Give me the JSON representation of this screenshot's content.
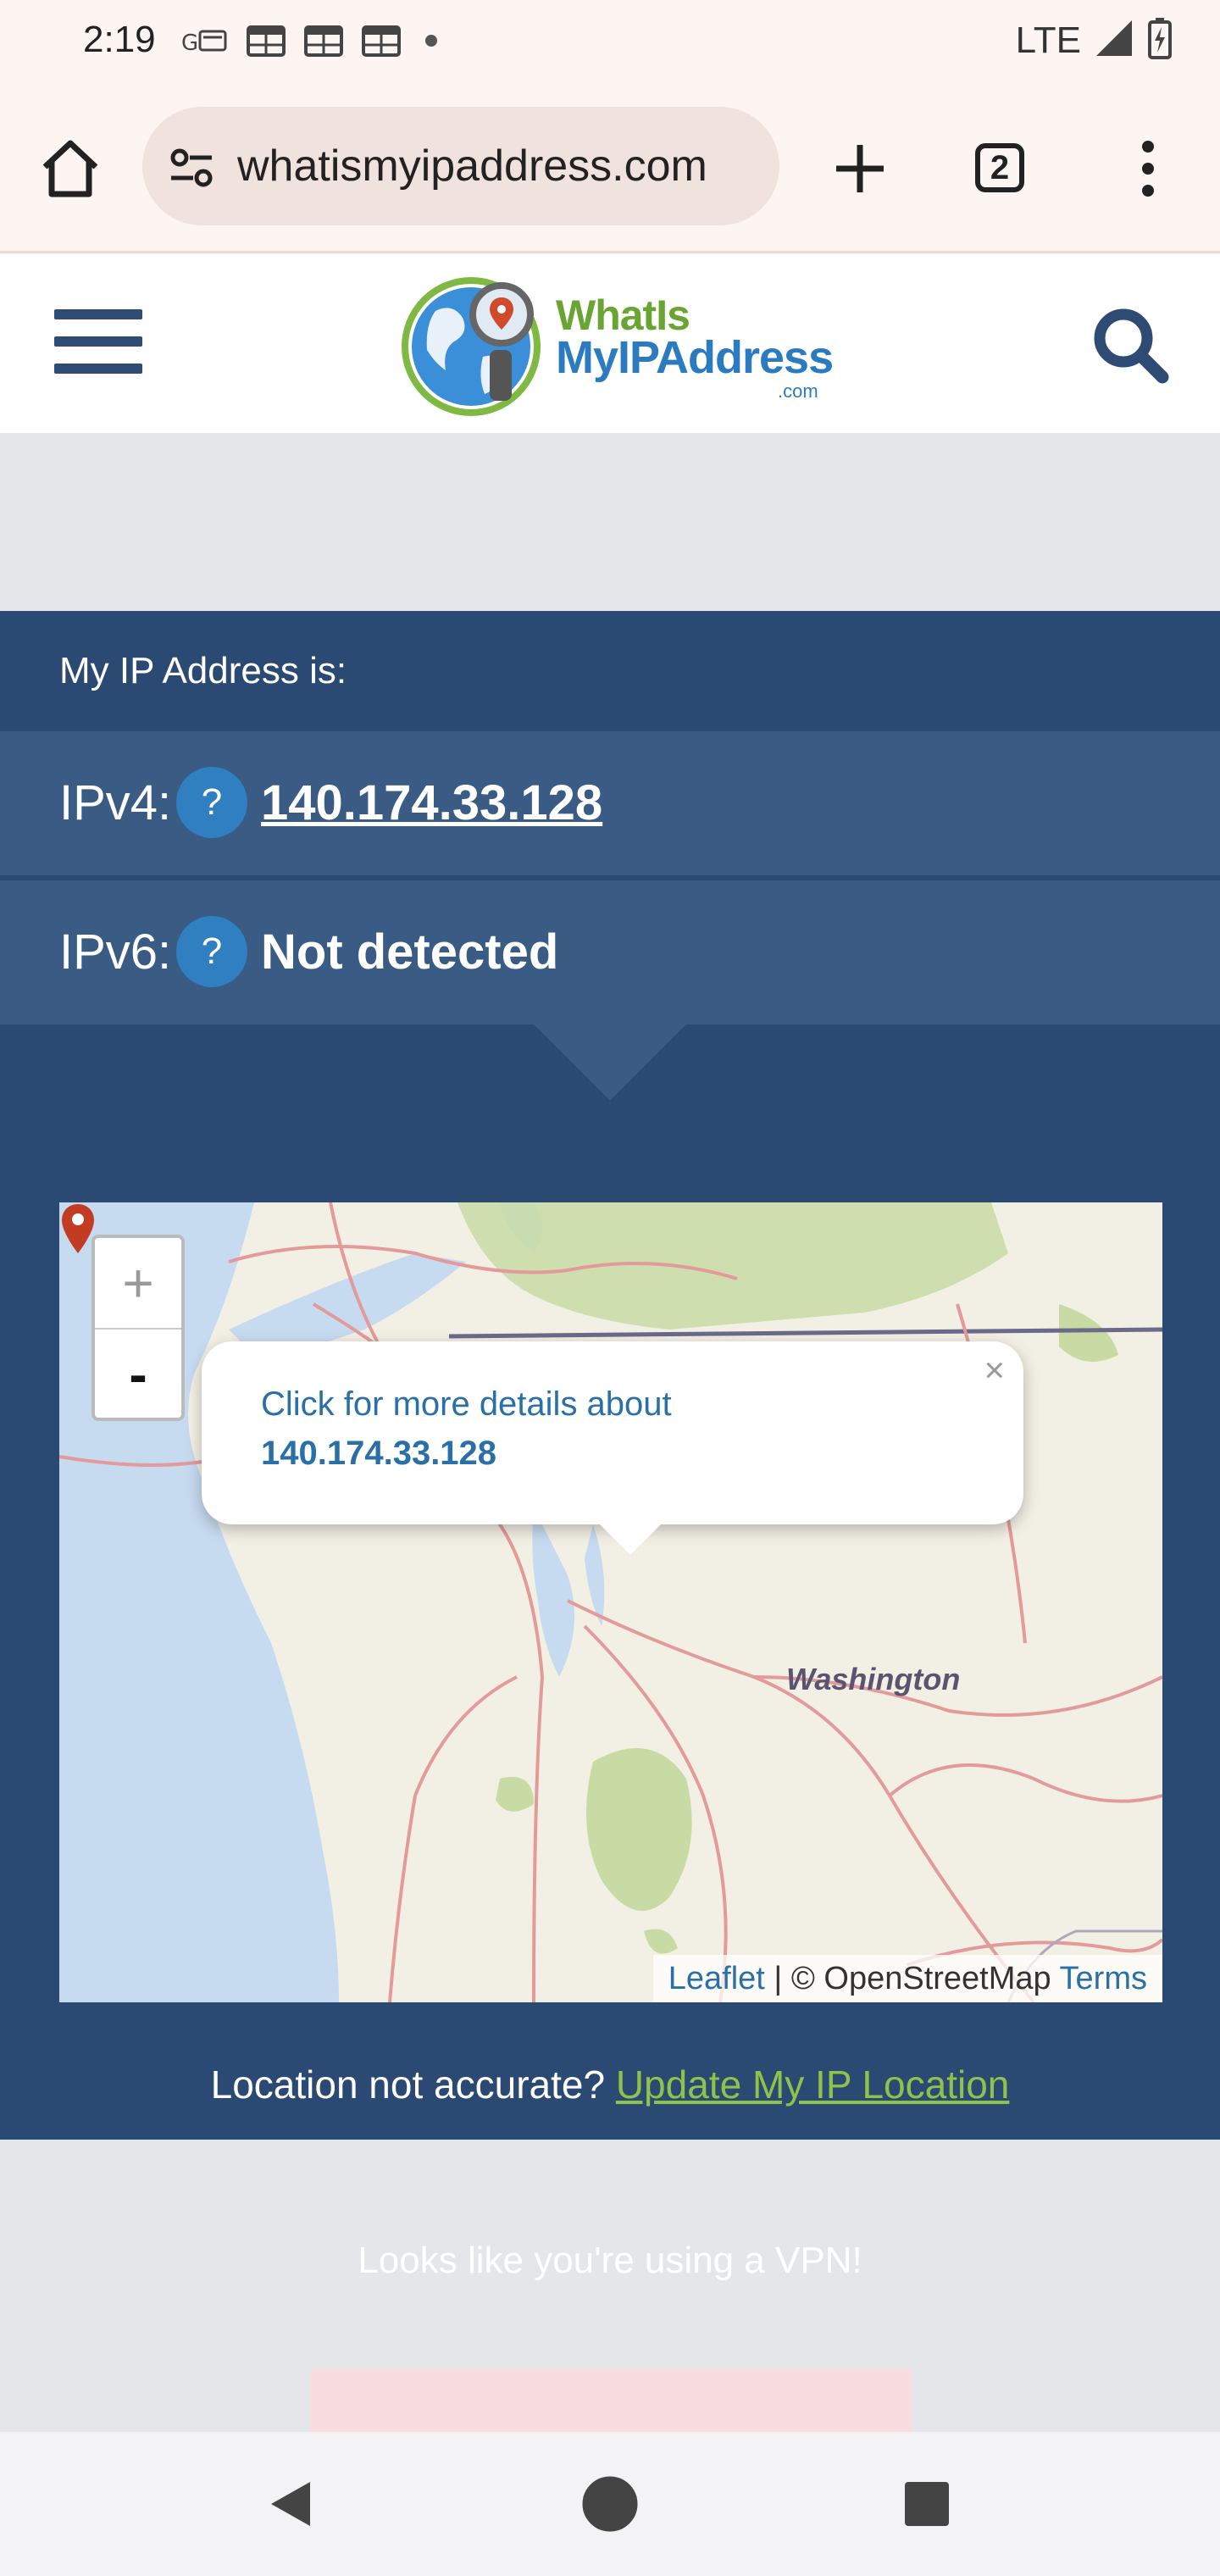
{
  "status_bar": {
    "time": "2:19",
    "network": "LTE",
    "icons": [
      "gs-icon",
      "calendar-icon",
      "calendar-icon",
      "calendar-icon",
      "dot-icon",
      "signal-icon",
      "battery-charging-icon"
    ]
  },
  "browser": {
    "url": "whatismyipaddress.com",
    "tab_count": "2"
  },
  "site": {
    "logo_line1": "WhatIs",
    "logo_line2": "MyIPAddress",
    "logo_line3": ".com"
  },
  "ip_panel": {
    "heading": "My IP Address is:",
    "ipv4_label": "IPv4:",
    "ipv4_value": "140.174.33.128",
    "ipv6_label": "IPv6:",
    "ipv6_value": "Not detected",
    "help_glyph": "?"
  },
  "map": {
    "zoom_in": "+",
    "zoom_out": "-",
    "popup_line1": "Click for more details about",
    "popup_line2": "140.174.33.128",
    "popup_close": "×",
    "region_label": "Washington",
    "attribution_leaflet": "Leaflet",
    "attribution_separator": " | © OpenStreetMap ",
    "attribution_terms": "Terms"
  },
  "location": {
    "prompt": "Location not accurate?",
    "link": "Update My IP Location"
  },
  "vpn": {
    "text": "Looks like you're using a VPN!"
  },
  "colors": {
    "panel": "#2b4a73",
    "row": "#3a5b84",
    "help": "#2f7fc1",
    "link_green": "#8fc24a",
    "logo_green": "#6aa533",
    "logo_blue": "#2b7bc0"
  }
}
